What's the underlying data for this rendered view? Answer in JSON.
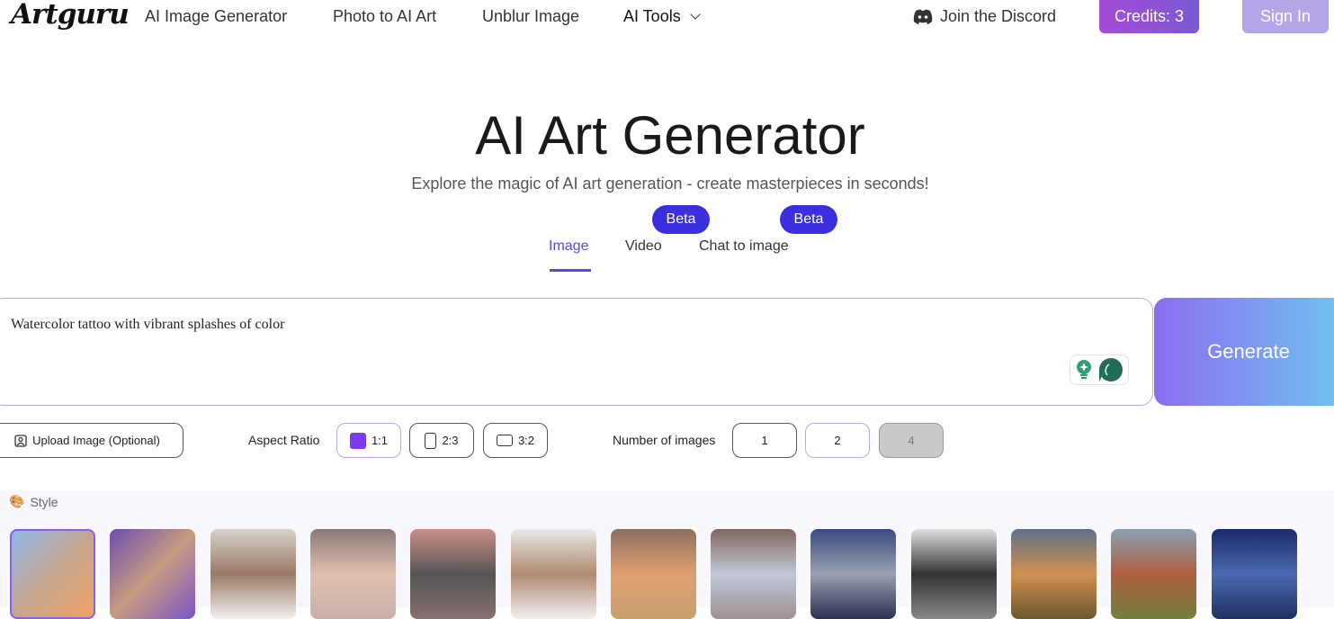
{
  "header": {
    "logo": "Artguru",
    "nav": [
      "AI Image Generator",
      "Photo to AI Art",
      "Unblur Image",
      "AI Tools"
    ],
    "discord": "Join the Discord",
    "credits": "Credits: 3",
    "sign_in": "Sign In"
  },
  "hero": {
    "title": "AI Art Generator",
    "subtitle": "Explore the magic of AI art generation - create masterpieces in seconds!"
  },
  "tabs": [
    {
      "label": "Image",
      "active": true
    },
    {
      "label": "Video",
      "badge": "Beta"
    },
    {
      "label": "Chat to image",
      "badge": "Beta"
    }
  ],
  "prompt": {
    "value": "Watercolor tattoo with vibrant splashes of color"
  },
  "generate": "Generate",
  "options": {
    "upload": "Upload Image (Optional)",
    "aspect_label": "Aspect Ratio",
    "aspects": [
      "1:1",
      "2:3",
      "3:2"
    ],
    "aspect_selected": "1:1",
    "count_label": "Number of images",
    "counts": [
      "1",
      "2",
      "4"
    ],
    "count_selected": "2",
    "count_disabled": "4"
  },
  "style": {
    "label": "Style",
    "tile_count": 13
  },
  "colors": {
    "accent": "#5b46e0",
    "beta": "#3b2fe0",
    "selected_aspect": "#7c3aed"
  }
}
